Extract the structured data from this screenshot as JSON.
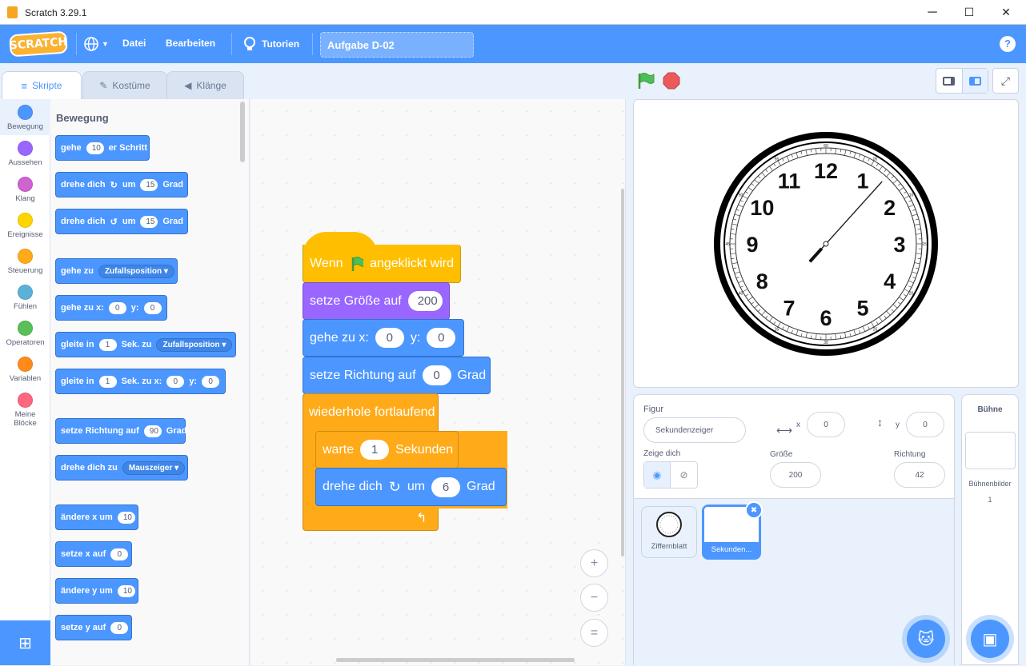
{
  "window": {
    "title": "Scratch 3.29.1",
    "minimize": "─",
    "maximize": "☐",
    "close": "✕"
  },
  "menu": {
    "logo": "SCRATCH",
    "file": "Datei",
    "edit": "Bearbeiten",
    "tutorials": "Tutorien",
    "project_title": "Aufgabe D-02",
    "help": "?"
  },
  "tabs": {
    "code": "Skripte",
    "costumes": "Kostüme",
    "sounds": "Klänge"
  },
  "categories": [
    {
      "label": "Bewegung",
      "color": "#4c97ff"
    },
    {
      "label": "Aussehen",
      "color": "#9966ff"
    },
    {
      "label": "Klang",
      "color": "#cf63cf"
    },
    {
      "label": "Ereignisse",
      "color": "#ffd500"
    },
    {
      "label": "Steuerung",
      "color": "#ffab19"
    },
    {
      "label": "Fühlen",
      "color": "#5cb1d6"
    },
    {
      "label": "Operatoren",
      "color": "#59c059"
    },
    {
      "label": "Variablen",
      "color": "#ff8c1a"
    },
    {
      "label": "Meine",
      "label2": "Blöcke",
      "color": "#ff6680"
    }
  ],
  "palette": {
    "heading": "Bewegung",
    "move": {
      "a": "gehe",
      "v": "10",
      "b": "er Schritt"
    },
    "turn_right": {
      "a": "drehe dich",
      "b": "um",
      "v": "15",
      "c": "Grad"
    },
    "turn_left": {
      "a": "drehe dich",
      "b": "um",
      "v": "15",
      "c": "Grad"
    },
    "goto": {
      "a": "gehe zu",
      "dd": "Zufallsposition"
    },
    "gotoxy": {
      "a": "gehe zu x:",
      "x": "0",
      "b": "y:",
      "y": "0"
    },
    "glide": {
      "a": "gleite in",
      "v": "1",
      "b": "Sek. zu",
      "dd": "Zufallsposition"
    },
    "glidexy": {
      "a": "gleite in",
      "v": "1",
      "b": "Sek. zu x:",
      "x": "0",
      "c": "y:",
      "y": "0"
    },
    "point": {
      "a": "setze Richtung auf",
      "v": "90",
      "b": "Grad"
    },
    "pointto": {
      "a": "drehe dich zu",
      "dd": "Mauszeiger"
    },
    "changex": {
      "a": "ändere x um",
      "v": "10"
    },
    "setx": {
      "a": "setze x auf",
      "v": "0"
    },
    "changey": {
      "a": "ändere y um",
      "v": "10"
    },
    "sety": {
      "a": "setze y auf",
      "v": "0"
    }
  },
  "script": {
    "hat": {
      "a": "Wenn",
      "b": "angeklickt wird"
    },
    "size": {
      "a": "setze Größe auf",
      "v": "200"
    },
    "goxy": {
      "a": "gehe zu x:",
      "x": "0",
      "b": "y:",
      "y": "0"
    },
    "dir": {
      "a": "setze Richtung auf",
      "v": "0",
      "b": "Grad"
    },
    "forever": "wiederhole fortlaufend",
    "wait": {
      "a": "warte",
      "v": "1",
      "b": "Sekunden"
    },
    "turn": {
      "a": "drehe dich",
      "b": "um",
      "v": "6",
      "c": "Grad"
    }
  },
  "zoom": {
    "in": "+",
    "out": "−",
    "reset": "="
  },
  "clock": {
    "numbers": [
      "12",
      "1",
      "2",
      "3",
      "4",
      "5",
      "6",
      "7",
      "8",
      "9",
      "10",
      "11"
    ],
    "minor_labels": [
      "60",
      "05",
      "10",
      "15",
      "20",
      "25",
      "30",
      "35",
      "40",
      "45",
      "50",
      "55"
    ]
  },
  "sprite": {
    "label_sprite": "Figur",
    "name": "Sekundenzeiger",
    "x_label": "x",
    "x": "0",
    "y_label": "y",
    "y": "0",
    "show_label": "Zeige dich",
    "size_label": "Größe",
    "size": "200",
    "direction_label": "Richtung",
    "direction": "42",
    "items": [
      {
        "name": "Ziffernblatt"
      },
      {
        "name": "Sekunden..."
      }
    ]
  },
  "stage_pane": {
    "title": "Bühne",
    "backdrops_label": "Bühnenbilder",
    "backdrops_count": "1"
  }
}
